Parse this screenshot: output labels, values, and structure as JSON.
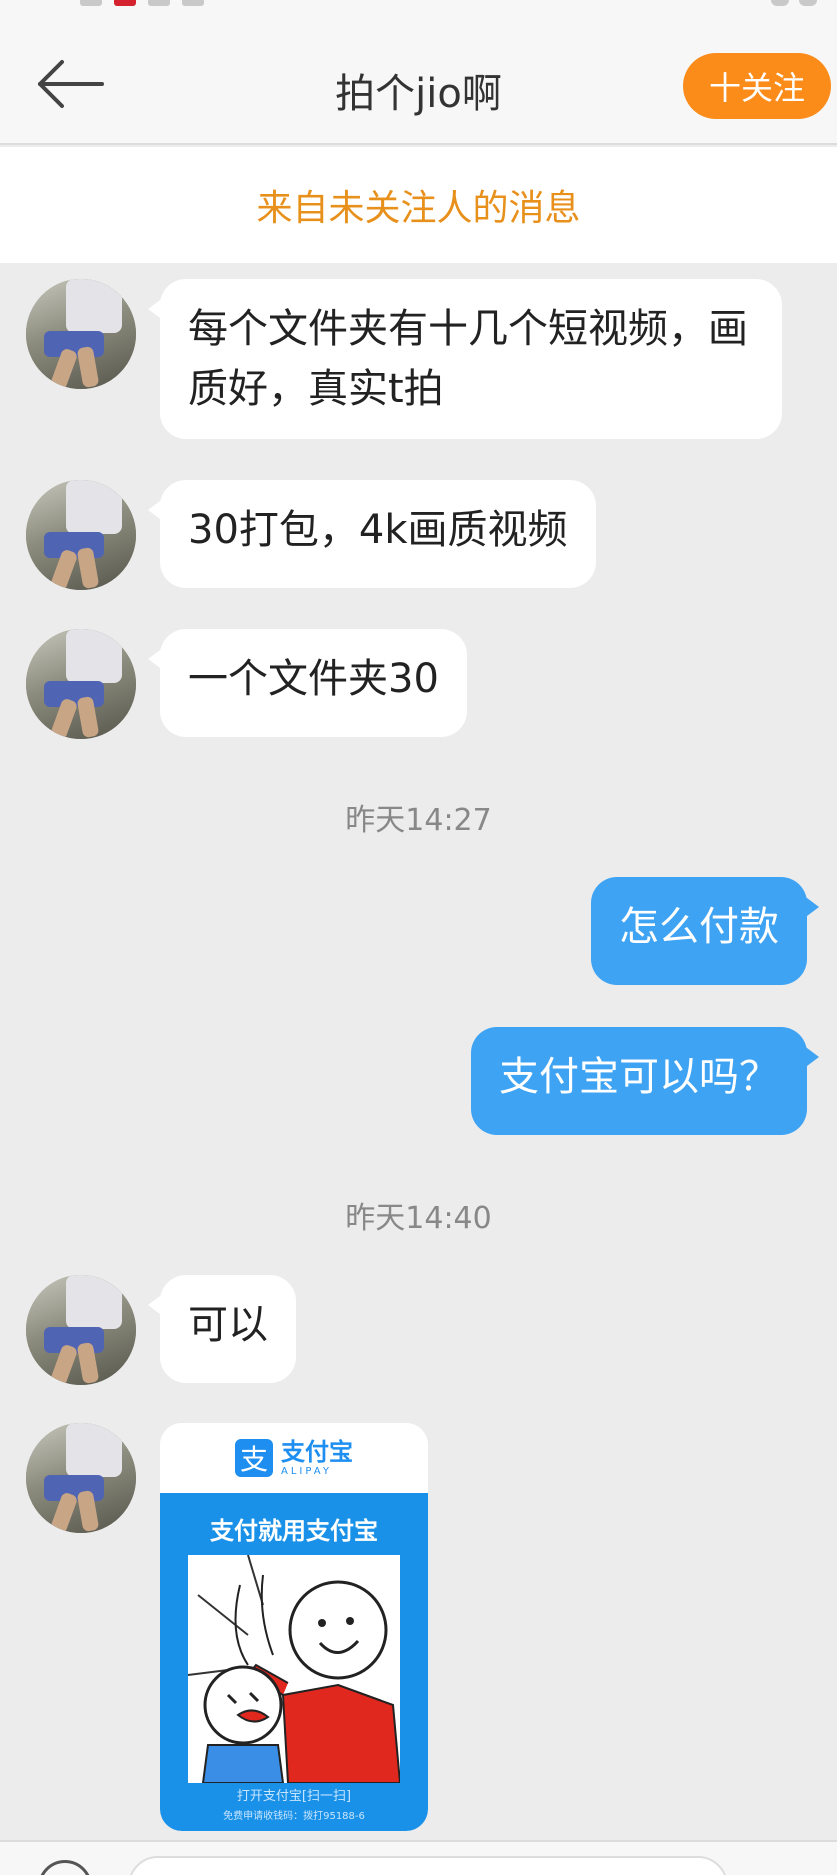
{
  "header": {
    "title": "拍个jio啊",
    "follow_label": "十关注"
  },
  "notice": "来自未关注人的消息",
  "messages": [
    {
      "from": "them",
      "text": "每个文件夹有十几个短视频，画质好，真实t拍"
    },
    {
      "from": "them",
      "text": "30打包，4k画质视频"
    },
    {
      "from": "them",
      "text": "一个文件夹30"
    },
    {
      "timestamp": "昨天14:27"
    },
    {
      "from": "me",
      "text": "怎么付款"
    },
    {
      "from": "me",
      "text": "支付宝可以吗？"
    },
    {
      "timestamp": "昨天14:40"
    },
    {
      "from": "them",
      "text": "可以"
    },
    {
      "from": "them",
      "type": "image"
    }
  ],
  "image_card": {
    "logo_cn": "支付宝",
    "logo_en": "ALIPAY",
    "logo_glyph": "支",
    "slogan": "支付就用支付宝",
    "footer_1": "打开支付宝[扫一扫]",
    "footer_2": "免费申请收钱码：拨打95188-6"
  },
  "colors": {
    "accent_orange": "#fb8c1a",
    "notice_orange": "#e8901c",
    "outgoing_bubble": "#3fa3f4",
    "alipay_blue": "#1a91e8"
  },
  "icons": [
    "back-arrow-icon",
    "voice-icon"
  ]
}
